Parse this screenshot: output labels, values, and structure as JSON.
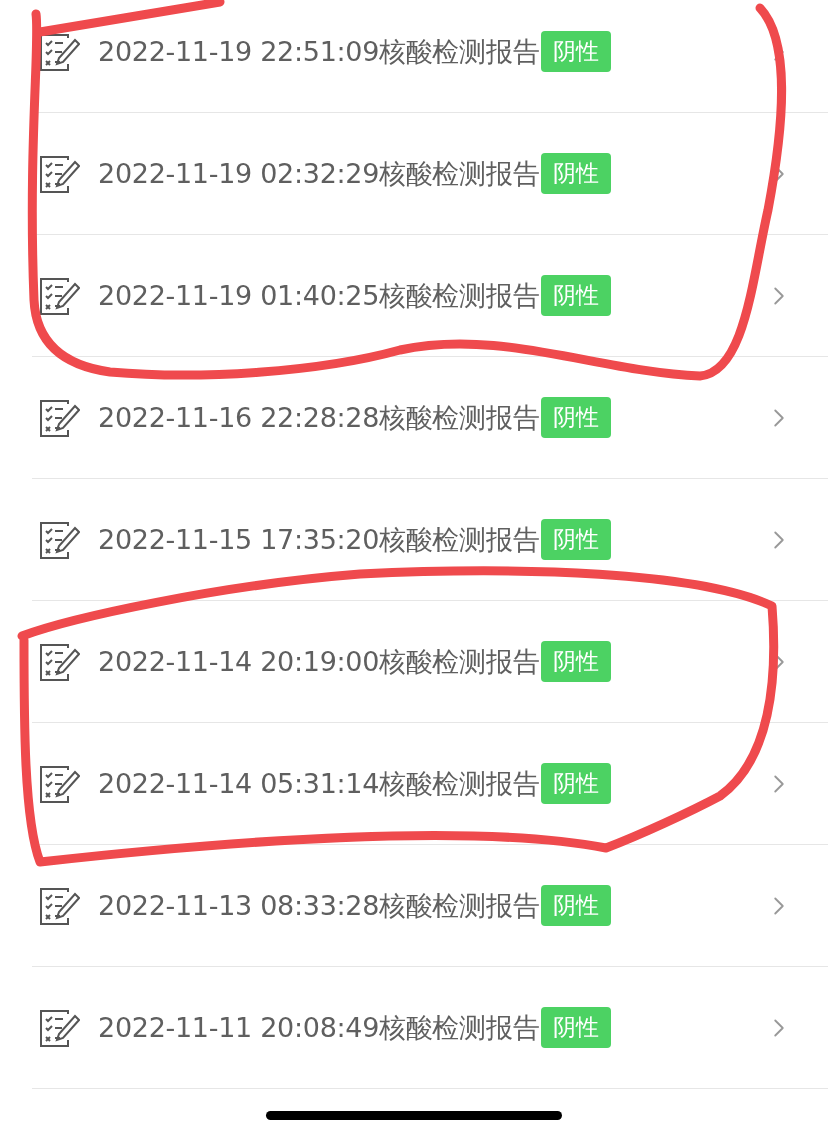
{
  "rows": [
    {
      "title": "2022-11-19 22:51:09核酸检测报告",
      "badge": "阴性"
    },
    {
      "title": "2022-11-19 02:32:29核酸检测报告",
      "badge": "阴性"
    },
    {
      "title": "2022-11-19 01:40:25核酸检测报告",
      "badge": "阴性"
    },
    {
      "title": "2022-11-16 22:28:28核酸检测报告",
      "badge": "阴性"
    },
    {
      "title": "2022-11-15 17:35:20核酸检测报告",
      "badge": "阴性"
    },
    {
      "title": "2022-11-14 20:19:00核酸检测报告",
      "badge": "阴性"
    },
    {
      "title": "2022-11-14 05:31:14核酸检测报告",
      "badge": "阴性"
    },
    {
      "title": "2022-11-13 08:33:28核酸检测报告",
      "badge": "阴性"
    },
    {
      "title": "2022-11-11 20:08:49核酸检测报告",
      "badge": "阴性"
    }
  ]
}
